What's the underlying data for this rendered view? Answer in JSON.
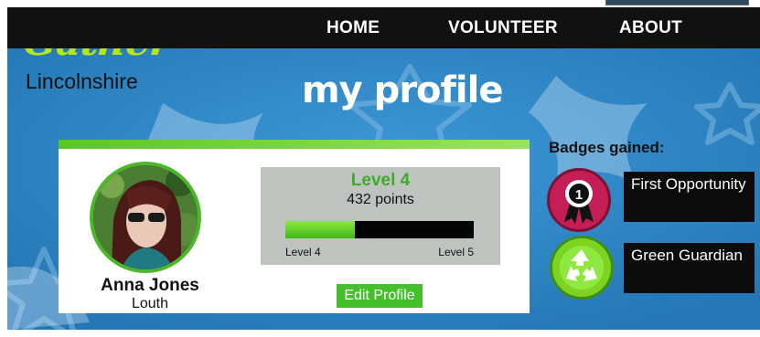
{
  "nav": {
    "items": [
      "HOME",
      "VOLUNTEER",
      "ABOUT"
    ]
  },
  "logo": {
    "main": "Gather",
    "sub": "Lincolnshire"
  },
  "page_title": "my profile",
  "profile": {
    "name": "Anna Jones",
    "location": "Louth",
    "level_title": "Level 4",
    "points": "432 points",
    "progress_fraction": 0.37,
    "level_from": "Level 4",
    "level_to": "Level 5",
    "edit_label": "Edit Profile"
  },
  "badges": {
    "title": "Badges gained:",
    "items": [
      {
        "icon": "ribbon-medal-icon",
        "label": "First Opportunity",
        "color": "#c41e55"
      },
      {
        "icon": "recycle-icon",
        "label": "Green Guardian",
        "color": "#7ed321"
      }
    ]
  },
  "colors": {
    "background": "#2f86c4",
    "accent_green": "#44c02b",
    "nav": "#111111"
  }
}
